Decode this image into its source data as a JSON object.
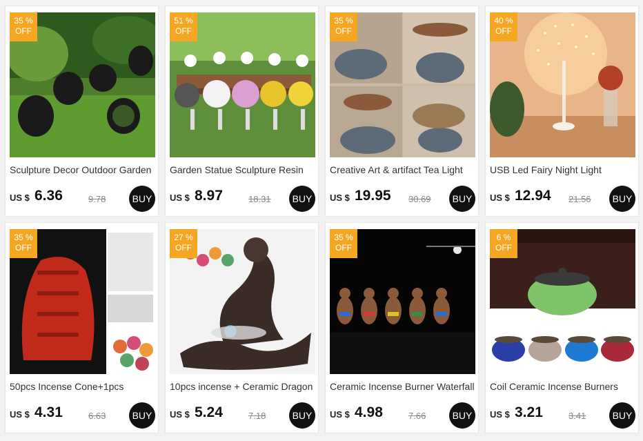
{
  "currency": "US $",
  "buy_label": "BUY",
  "products": [
    {
      "title": "Sculpture Decor Outdoor Garden",
      "discount": "35 %",
      "off": "OFF",
      "price": "6.36",
      "old_price": "9.78",
      "image": "black-metal-chickens-on-lawn"
    },
    {
      "title": "Garden Statue Sculpture Resin",
      "discount": "51 %",
      "off": "OFF",
      "price": "8.97",
      "old_price": "18.31",
      "image": "resin-chickens-on-bench"
    },
    {
      "title": "Creative Art & artifact Tea Light",
      "discount": "35 %",
      "off": "OFF",
      "price": "19.95",
      "old_price": "30.69",
      "image": "whale-tea-light-holder"
    },
    {
      "title": "USB Led Fairy Night Light",
      "discount": "40 %",
      "off": "OFF",
      "price": "12.94",
      "old_price": "21.56",
      "image": "led-fairy-tree-lamp"
    },
    {
      "title": "50pcs Incense Cone+1pcs",
      "discount": "35 %",
      "off": "OFF",
      "price": "4.31",
      "old_price": "6.63",
      "image": "red-waterfall-incense-burner"
    },
    {
      "title": "10pcs incense + Ceramic Dragon",
      "discount": "27 %",
      "off": "OFF",
      "price": "5.24",
      "old_price": "7.18",
      "image": "ceramic-dragon-incense-burner"
    },
    {
      "title": "Ceramic Incense Burner Waterfall",
      "discount": "35 %",
      "off": "OFF",
      "price": "4.98",
      "old_price": "7.66",
      "image": "monk-incense-burners"
    },
    {
      "title": "Coil Ceramic Incense Burners",
      "discount": "6 %",
      "off": "OFF",
      "price": "3.21",
      "old_price": "3.41",
      "image": "coil-ceramic-burners"
    }
  ]
}
